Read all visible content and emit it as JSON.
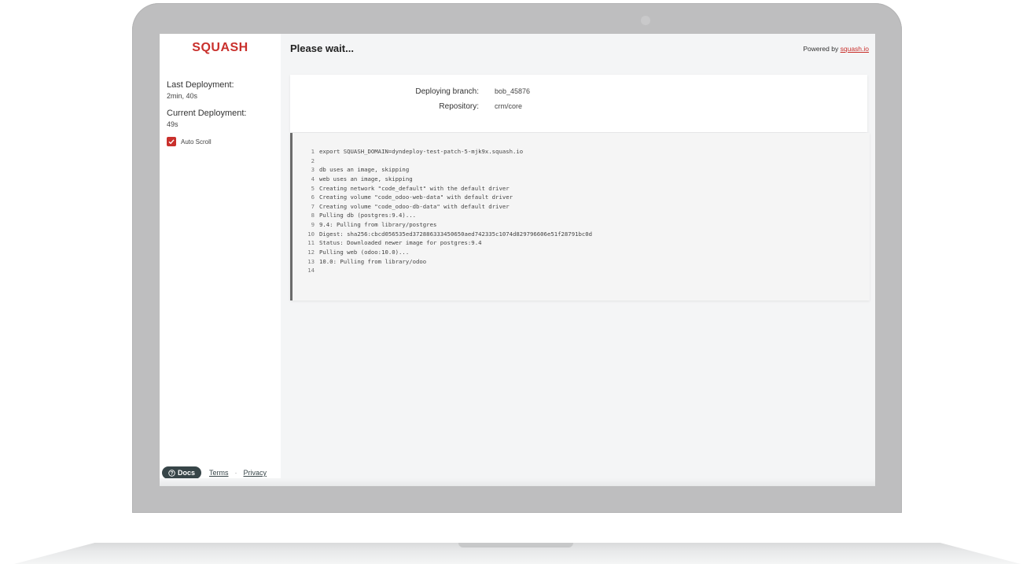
{
  "sidebar": {
    "logo": "SQUASH",
    "last_deployment_label": "Last Deployment:",
    "last_deployment_value": "2min, 40s",
    "current_deployment_label": "Current Deployment:",
    "current_deployment_value": "49s",
    "auto_scroll_label": "Auto Scroll",
    "auto_scroll_checked": true,
    "footer": {
      "docs_label": "Docs",
      "terms_label": "Terms",
      "separator": "·",
      "privacy_label": "Privacy"
    }
  },
  "header": {
    "title": "Please wait...",
    "powered_by": "Powered by",
    "powered_link": "squash.io"
  },
  "info": {
    "branch_label": "Deploying branch:",
    "branch_value": "bob_45876",
    "repo_label": "Repository:",
    "repo_value": "crm/core"
  },
  "log": {
    "lines": [
      {
        "num": "1",
        "text": "export SQUASH_DOMAIN=dyndeploy-test-patch-5-mjk9x.squash.io"
      },
      {
        "num": "2",
        "text": ""
      },
      {
        "num": "3",
        "text": "db uses an image, skipping"
      },
      {
        "num": "4",
        "text": "web uses an image, skipping"
      },
      {
        "num": "5",
        "text": "Creating network \"code_default\" with the default driver"
      },
      {
        "num": "6",
        "text": "Creating volume \"code_odoo-web-data\" with default driver"
      },
      {
        "num": "7",
        "text": "Creating volume \"code_odoo-db-data\" with default driver"
      },
      {
        "num": "8",
        "text": "Pulling db (postgres:9.4)..."
      },
      {
        "num": "9",
        "text": "9.4: Pulling from library/postgres"
      },
      {
        "num": "10",
        "text": "Digest: sha256:cbcd056535ed372886333450650aed742335c1074d829796606e51f28791bc0d"
      },
      {
        "num": "11",
        "text": "Status: Downloaded newer image for postgres:9.4"
      },
      {
        "num": "12",
        "text": "Pulling web (odoo:10.0)..."
      },
      {
        "num": "13",
        "text": "10.0: Pulling from library/odoo"
      },
      {
        "num": "14",
        "text": ""
      }
    ]
  },
  "colors": {
    "brand": "#c9302c",
    "docs_button": "#374548",
    "laptop_frame": "#bebebf"
  }
}
